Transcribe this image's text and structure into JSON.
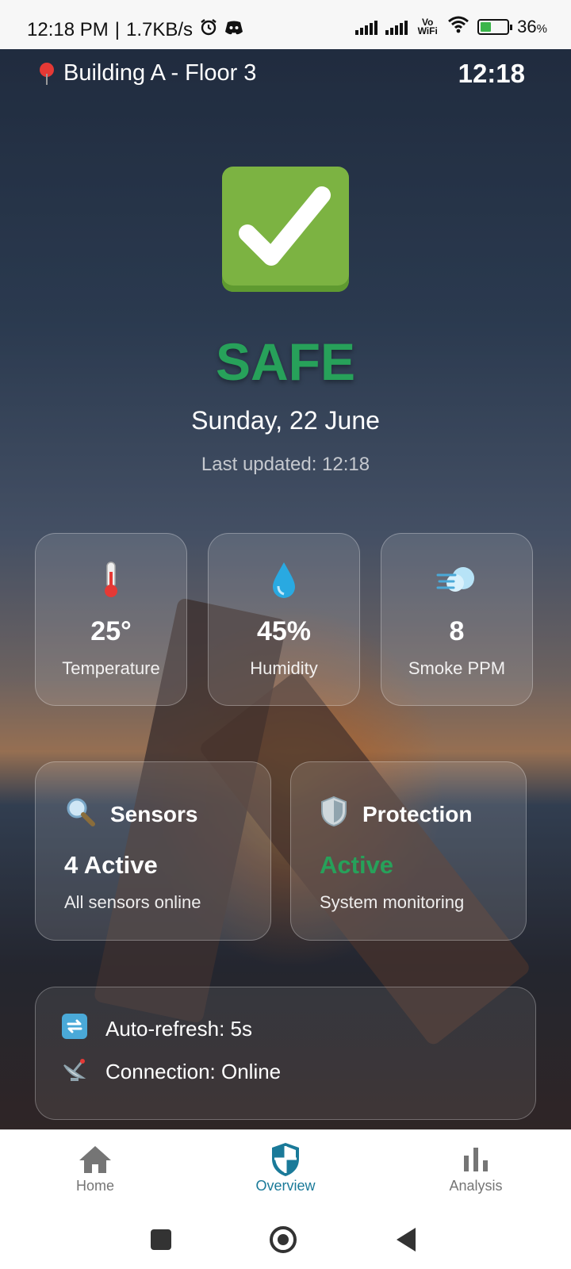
{
  "status_bar": {
    "time": "12:18 PM",
    "speed": "1.7KB/s",
    "battery_percent": "36",
    "battery_unit": "%",
    "network_label": "Vo WiFi",
    "icons": [
      "alarm-icon",
      "discord-icon",
      "signal-icon",
      "wifi-icon",
      "battery-icon"
    ]
  },
  "header": {
    "location": "Building A - Floor 3",
    "clock": "12:18"
  },
  "status": {
    "icon": "check-mark-icon",
    "label": "SAFE",
    "date": "Sunday, 22 June",
    "last_updated": "Last updated: 12:18",
    "color": "#27a15a"
  },
  "metrics": [
    {
      "icon": "thermometer-icon",
      "value": "25°",
      "label": "Temperature"
    },
    {
      "icon": "water-drop-icon",
      "value": "45%",
      "label": "Humidity"
    },
    {
      "icon": "smoke-icon",
      "value": "8",
      "label": "Smoke PPM"
    }
  ],
  "cards": {
    "sensors": {
      "icon": "magnifier-icon",
      "title": "Sensors",
      "status": "4 Active",
      "subtitle": "All sensors online"
    },
    "protection": {
      "icon": "shield-icon",
      "title": "Protection",
      "status": "Active",
      "subtitle": "System monitoring",
      "status_color": "#27a15a"
    }
  },
  "info": {
    "refresh": "Auto-refresh: 5s",
    "connection": "Connection: Online"
  },
  "bottom_nav": {
    "items": [
      {
        "label": "Home",
        "icon": "home-icon"
      },
      {
        "label": "Overview",
        "icon": "shield-icon",
        "active": true
      },
      {
        "label": "Analysis",
        "icon": "bar-chart-icon"
      }
    ],
    "active_color": "#1a7a99"
  }
}
